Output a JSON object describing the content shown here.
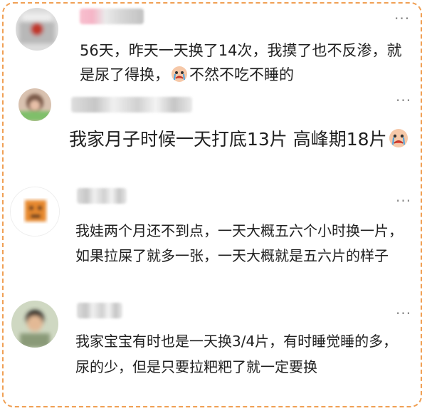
{
  "comments": [
    {
      "avatar_icon": "blurred-avatar-icon",
      "text_a": "56天，昨天一天换了14次，我摸了也不反渗，就是尿了得换，",
      "emoji": "crying-face-emoji",
      "text_b": "不然不吃不睡的"
    },
    {
      "avatar_icon": "blurred-avatar-icon",
      "more_label": "···",
      "text_a": "我家月子时候一天打底13片 高峰期18片",
      "emoji": "crying-face-emoji"
    },
    {
      "avatar_icon": "blurred-avatar-icon",
      "more_label": "···",
      "text_a": "我娃两个月还不到点，一天大概五六个小时换一片，如果拉屎了就多一张，一天大概就是五六片的样子"
    },
    {
      "avatar_icon": "blurred-avatar-icon",
      "more_label": "···",
      "text_a": "我家宝宝有时也是一天换3/4片，有时睡觉睡的多，尿的少，但是只要拉粑粑了就一定要换"
    }
  ],
  "top_more_label": "···",
  "colors": {
    "border": "#f0a055",
    "text": "#1f1f1f",
    "muted": "#888888"
  }
}
